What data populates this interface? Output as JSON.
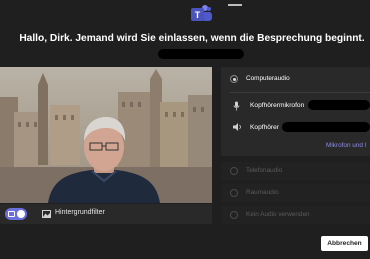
{
  "header": {
    "waiting_message": "Hallo, Dirk. Jemand wird Sie einlassen, wenn die Besprechung beginnt.",
    "app_icon": "teams-icon"
  },
  "video_preview": {
    "background_filter_label": "Hintergrundfilter",
    "camera_on": true,
    "accent_color": "#6b6ee0"
  },
  "audio": {
    "computer_audio_label": "Computeraudio",
    "microphone_label": "Kopfhörermikrofon",
    "speaker_label": "Kopfhörer",
    "devices_link_label": "Mikrofon und l",
    "phone_audio_label": "Telefonaudio",
    "room_audio_label": "Raumaudio",
    "no_audio_label": "Kein Audio verwenden"
  },
  "actions": {
    "cancel_label": "Abbrechen"
  }
}
